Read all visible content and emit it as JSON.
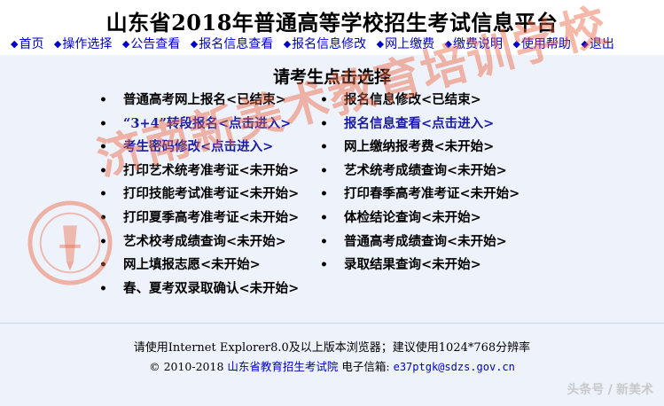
{
  "header": {
    "title": "山东省2018年普通高等学校招生考试信息平台",
    "nav": [
      {
        "label": "首页"
      },
      {
        "label": "操作选择"
      },
      {
        "label": "公告查看"
      },
      {
        "label": "报名信息查看"
      },
      {
        "label": "报名信息修改"
      },
      {
        "label": "网上缴费"
      },
      {
        "label": "缴费说明"
      },
      {
        "label": "使用帮助"
      },
      {
        "label": "退出"
      }
    ]
  },
  "main": {
    "title": "请考生点击选择",
    "bullet": "•",
    "left_items": [
      {
        "label": "普通高考网上报名<已结束>",
        "status": "ended"
      },
      {
        "label": "“3+4”转段报名<点击进入>",
        "status": "open"
      },
      {
        "label": "考生密码修改<点击进入>",
        "status": "open"
      },
      {
        "label": "打印艺术统考准考证<未开始>",
        "status": "pending"
      },
      {
        "label": "打印技能考试准考证<未开始>",
        "status": "pending"
      },
      {
        "label": "打印夏季高考准考证<未开始>",
        "status": "pending"
      },
      {
        "label": "艺术校考成绩查询<未开始>",
        "status": "pending"
      },
      {
        "label": "网上填报志愿<未开始>",
        "status": "pending"
      },
      {
        "label": "春、夏考双录取确认<未开始>",
        "status": "pending"
      }
    ],
    "right_items": [
      {
        "label": "报名信息修改<已结束>",
        "status": "ended"
      },
      {
        "label": "报名信息查看<点击进入>",
        "status": "open"
      },
      {
        "label": "网上缴纳报考费<未开始>",
        "status": "pending"
      },
      {
        "label": "艺术统考成绩查询<未开始>",
        "status": "pending"
      },
      {
        "label": "打印春季高考准考证<未开始>",
        "status": "pending"
      },
      {
        "label": "体检结论查询<未开始>",
        "status": "pending"
      },
      {
        "label": "普通高考成绩查询<未开始>",
        "status": "pending"
      },
      {
        "label": "录取结果查询<未开始>",
        "status": "pending"
      }
    ]
  },
  "footer": {
    "browser_note": "请使用Internet Explorer8.0及以上版本浏览器；建议使用1024*768分辨率",
    "copyright": "© 2010-2018",
    "institute": "山东省教育招生考试院",
    "email_label": "电子信箱:",
    "email": "e37ptgk@sdzs.gov.cn"
  },
  "watermarks": {
    "overlay_text": "济南新美术教育培训学校",
    "corner_text": "头条号 / 新美术"
  },
  "colors": {
    "link": "#0000cc",
    "open_status": "#1a1aa6",
    "page_bg": "#eef3fb",
    "watermark": "#ec623e"
  }
}
